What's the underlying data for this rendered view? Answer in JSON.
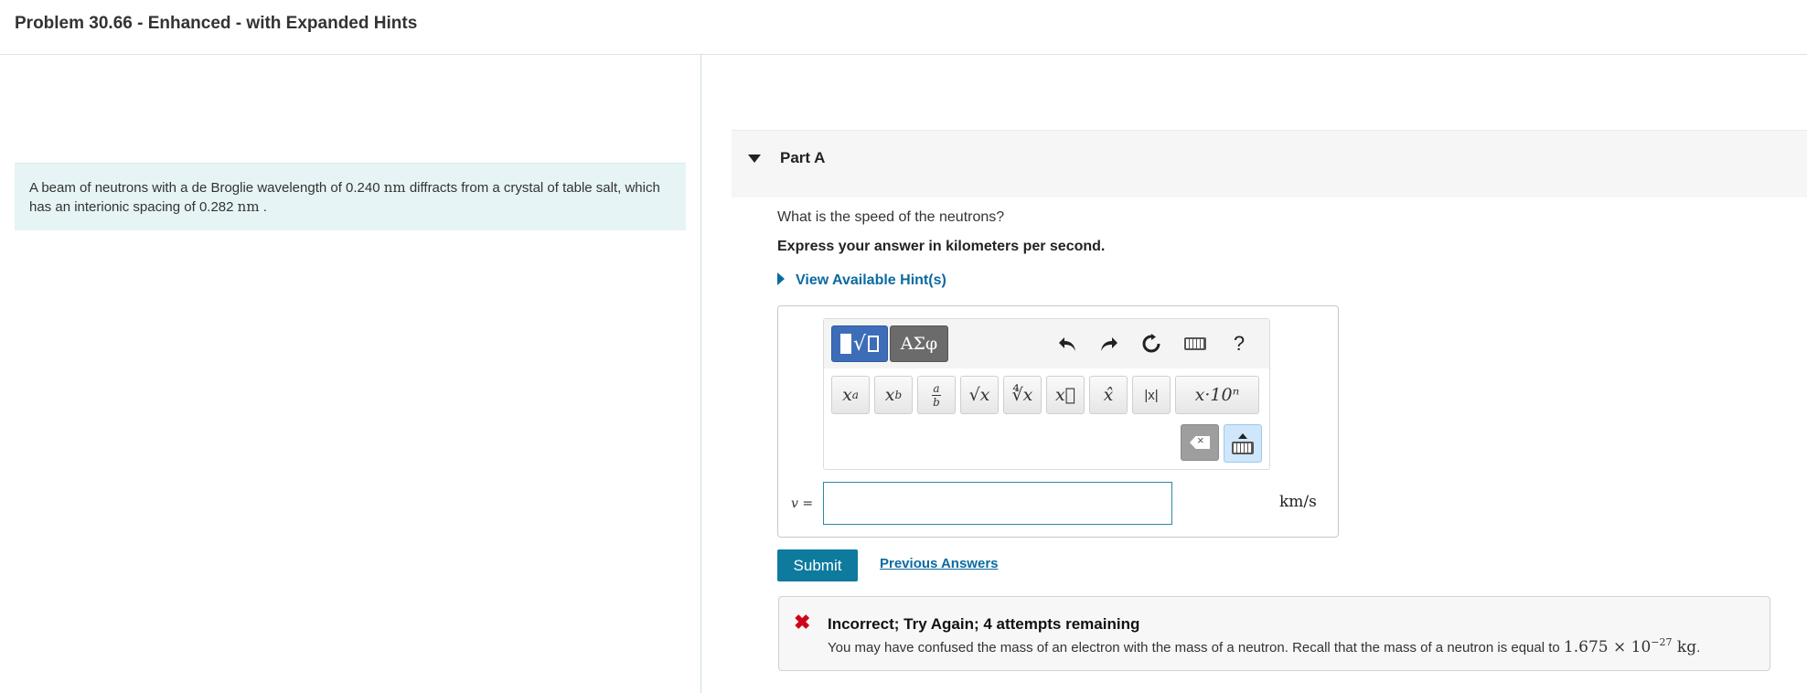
{
  "header": {
    "title": "Problem 30.66 - Enhanced - with Expanded Hints"
  },
  "problem": {
    "text_1": "A beam of neutrons with a de Broglie wavelength of 0.240 ",
    "unit_1": "nm",
    "text_2": " diffracts from a crystal of table salt, which has an interionic spacing of 0.282 ",
    "unit_2": "nm",
    "text_3": " ."
  },
  "part": {
    "title": "Part A"
  },
  "question": {
    "prompt": "What is the speed of the neutrons?",
    "instruction": "Express your answer in kilometers per second.",
    "hints_label": "View Available Hint(s)"
  },
  "answer": {
    "variable": "v",
    "equals": " =",
    "value": "",
    "unit": "km/s"
  },
  "toolbar": {
    "symbols_tab": "ΑΣφ",
    "help": "?",
    "buttons": {
      "superscript_base": "x",
      "superscript_exp": "a",
      "subscript_base": "x",
      "subscript_sub": "b",
      "fraction_num": "a",
      "fraction_den": "b",
      "sqrt": "√x",
      "nthroot": "∜x",
      "vector": "x⃗",
      "hat": "x̂",
      "abs": "|x|",
      "sci": "x·10ⁿ"
    }
  },
  "actions": {
    "submit": "Submit",
    "previous_answers": "Previous Answers"
  },
  "feedback": {
    "status": "Incorrect; Try Again; 4 attempts remaining",
    "message_1": "You may have confused the mass of an electron with the mass of a neutron. Recall that the mass of a neutron is equal to ",
    "mass_value": "1.675 × 10",
    "mass_exp": "−27",
    "mass_unit": " kg",
    "message_end": "."
  },
  "colors": {
    "accent": "#0d7a9e",
    "link": "#0a6aa0",
    "error": "#d0021b",
    "problem_bg": "#e6f4f5"
  }
}
